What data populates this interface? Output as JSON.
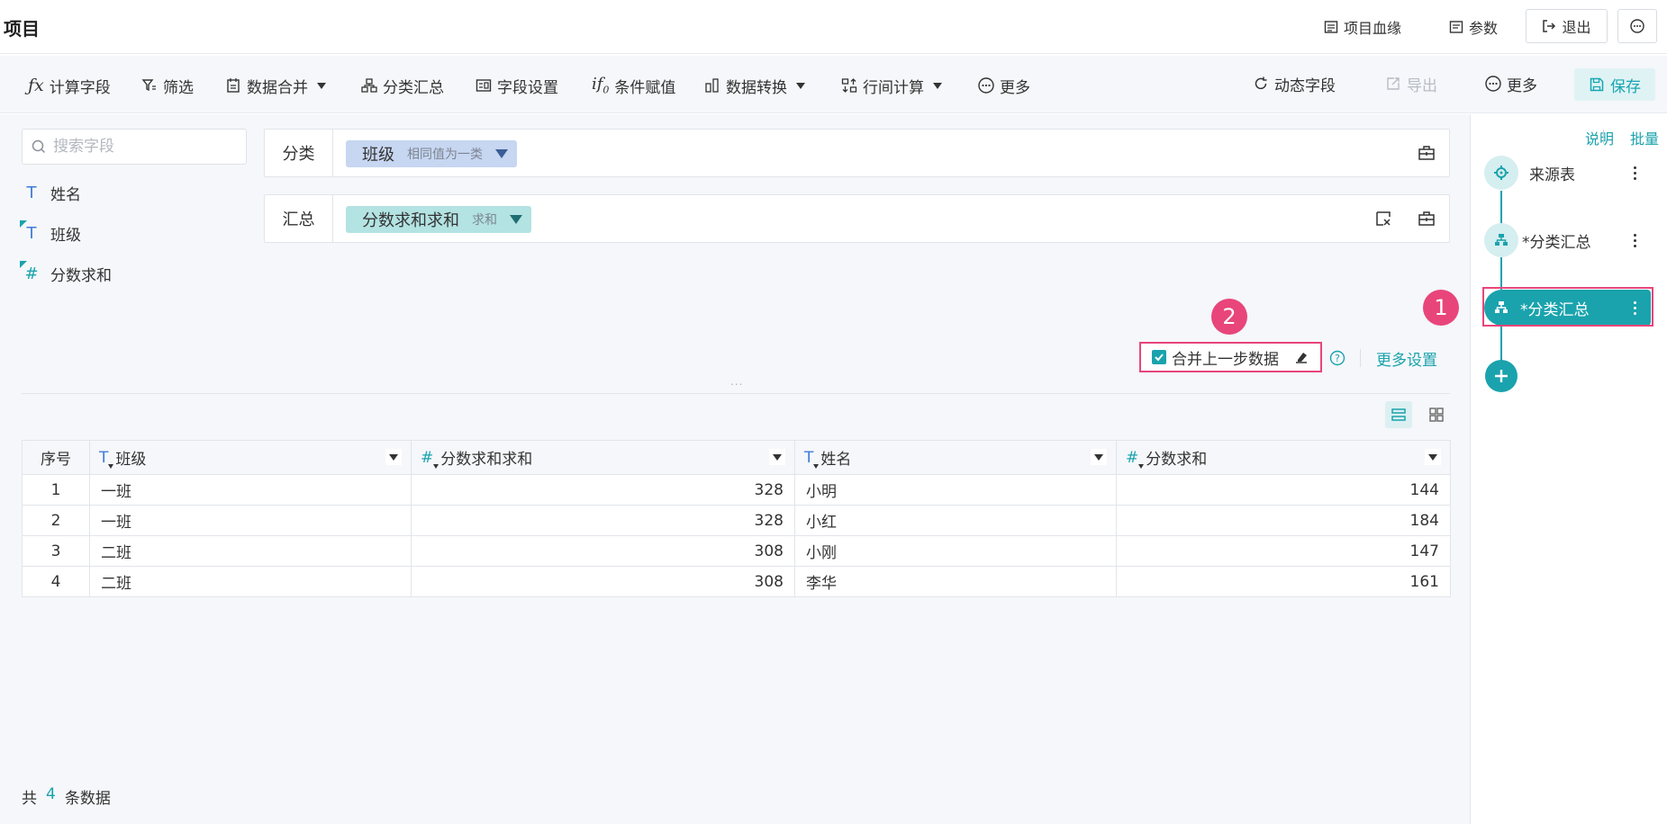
{
  "header": {
    "title": "项目",
    "lineage": "项目血缘",
    "params": "参数",
    "exit": "退出"
  },
  "toolbar": {
    "calc_field": "计算字段",
    "filter": "筛选",
    "merge": "数据合并",
    "group_summary": "分类汇总",
    "field_settings": "字段设置",
    "conditional": "条件赋值",
    "transform": "数据转换",
    "row_calc": "行间计算",
    "more_left": "更多",
    "dynamic_field": "动态字段",
    "export": "导出",
    "more_right": "更多",
    "save": "保存"
  },
  "fields": {
    "search_placeholder": "搜索字段",
    "items": [
      {
        "type": "T",
        "label": "姓名"
      },
      {
        "type": "T",
        "label": "班级"
      },
      {
        "type": "#",
        "label": "分数求和"
      }
    ]
  },
  "config": {
    "group_label": "分类",
    "group_field": "班级",
    "group_mode": "相同值为一类",
    "summary_label": "汇总",
    "summary_field": "分数求和求和",
    "summary_mode": "求和"
  },
  "options": {
    "merge_prev": "合并上一步数据",
    "more_settings": "更多设置",
    "badge_1": "1",
    "badge_2": "2",
    "split_dots": "..."
  },
  "table": {
    "columns": [
      {
        "label": "序号",
        "type": ""
      },
      {
        "label": "班级",
        "type": "T"
      },
      {
        "label": "分数求和求和",
        "type": "#"
      },
      {
        "label": "姓名",
        "type": "T"
      },
      {
        "label": "分数求和",
        "type": "#"
      }
    ],
    "rows": [
      [
        "1",
        "一班",
        "328",
        "小明",
        "144"
      ],
      [
        "2",
        "一班",
        "328",
        "小红",
        "184"
      ],
      [
        "3",
        "二班",
        "308",
        "小刚",
        "147"
      ],
      [
        "4",
        "二班",
        "308",
        "李华",
        "161"
      ]
    ],
    "total_prefix": "共",
    "total_count": "4",
    "total_suffix": "条数据"
  },
  "right_panel": {
    "explain": "说明",
    "batch": "批量",
    "steps": [
      {
        "label": "来源表",
        "icon": "source-table-icon"
      },
      {
        "label": "*分类汇总",
        "icon": "group-summary-icon"
      },
      {
        "label": "*分类汇总",
        "icon": "group-summary-icon"
      }
    ]
  },
  "colors": {
    "accent": "#1aa3ad",
    "highlight": "#e8457b",
    "blue_pill": "#c7d6f1",
    "teal_pill": "#b3e3e2"
  }
}
